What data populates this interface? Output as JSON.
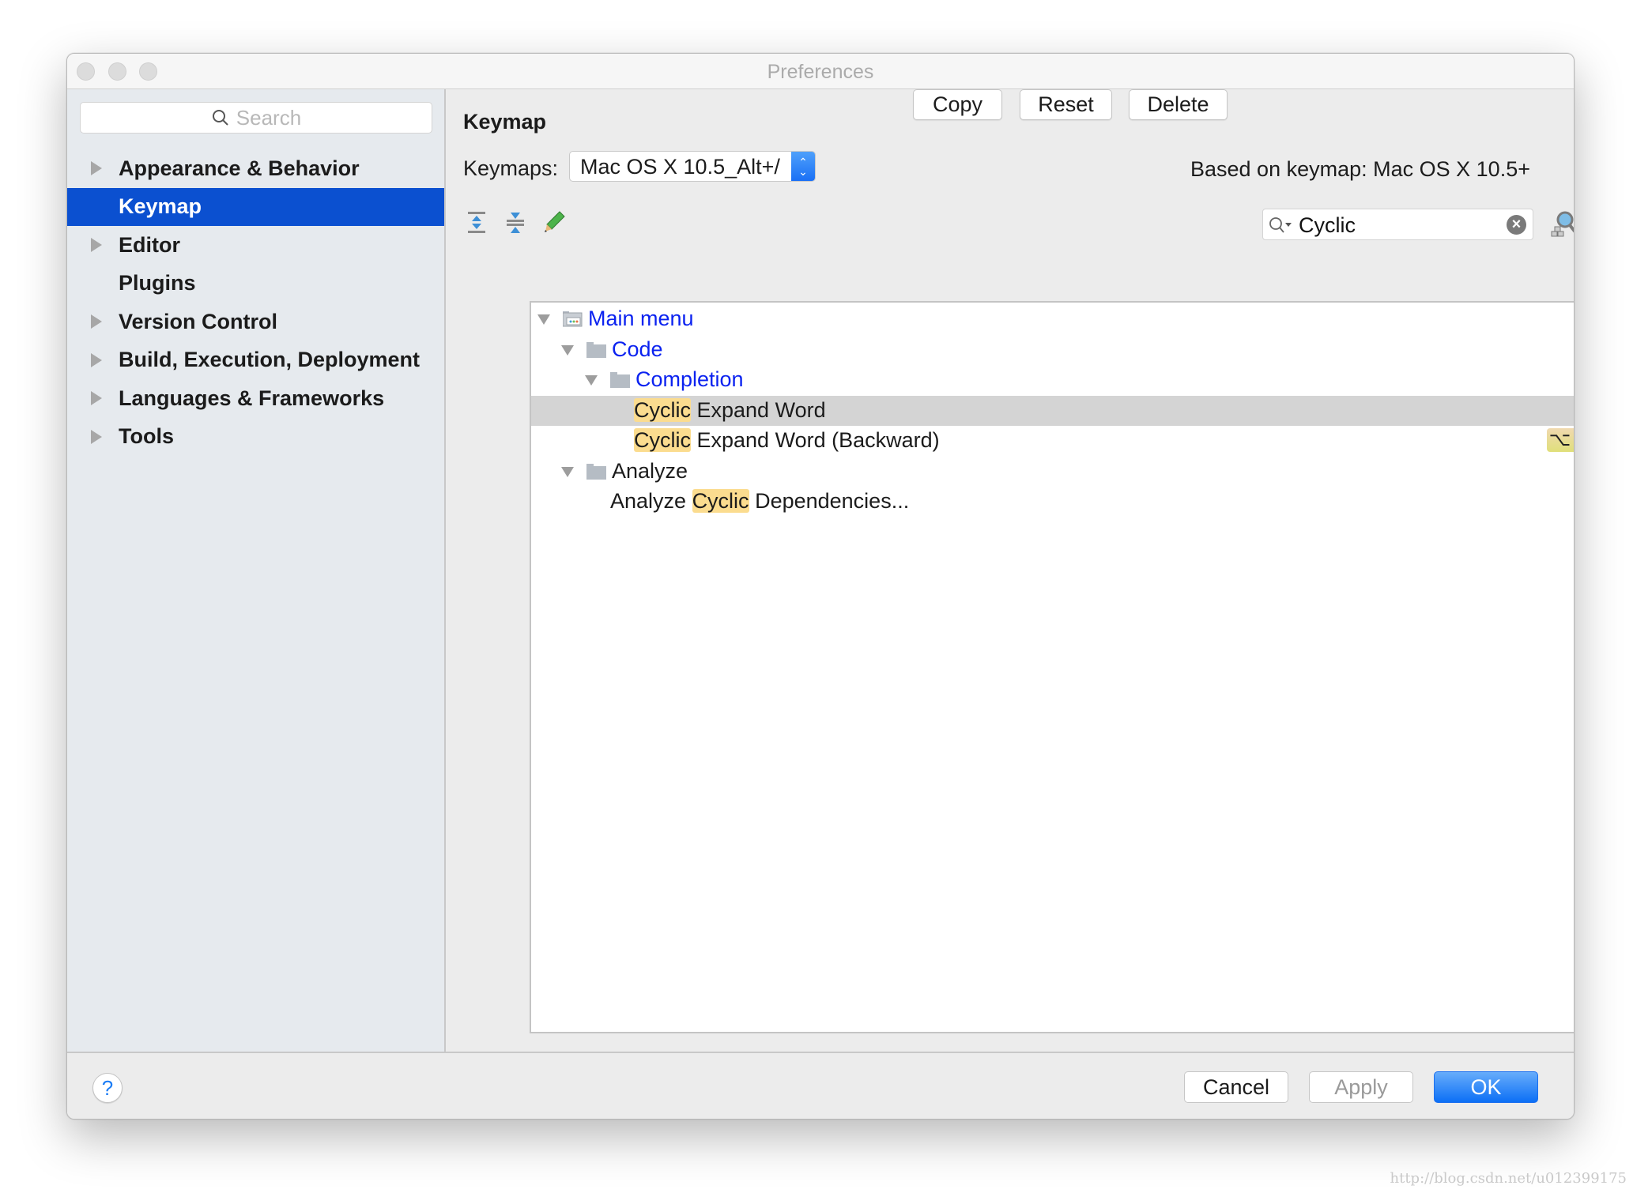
{
  "window": {
    "title": "Preferences"
  },
  "sidebar": {
    "search_placeholder": "Search",
    "items": [
      {
        "label": "Appearance & Behavior",
        "expandable": true,
        "selected": false
      },
      {
        "label": "Keymap",
        "expandable": false,
        "selected": true
      },
      {
        "label": "Editor",
        "expandable": true,
        "selected": false
      },
      {
        "label": "Plugins",
        "expandable": false,
        "selected": false
      },
      {
        "label": "Version Control",
        "expandable": true,
        "selected": false
      },
      {
        "label": "Build, Execution, Deployment",
        "expandable": true,
        "selected": false
      },
      {
        "label": "Languages & Frameworks",
        "expandable": true,
        "selected": false
      },
      {
        "label": "Tools",
        "expandable": true,
        "selected": false
      }
    ]
  },
  "keymap": {
    "heading": "Keymap",
    "keymaps_label": "Keymaps:",
    "selected_keymap": "Mac OS X 10.5_Alt+/",
    "copy_label": "Copy",
    "reset_label": "Reset",
    "delete_label": "Delete",
    "based_on": "Based on keymap: Mac OS X 10.5+",
    "toolbar": {
      "expand_all_icon": "expand-all-icon",
      "collapse_all_icon": "collapse-all-icon",
      "edit_icon": "pencil-icon"
    },
    "filter_value": "Cyclic",
    "find_by_shortcut_icon": "find-by-shortcut-icon"
  },
  "tree": {
    "rows": [
      {
        "level": 0,
        "expanded": true,
        "icon": "main-menu-icon",
        "pre": "",
        "match": "",
        "post": "Main menu",
        "link": true,
        "selected": false,
        "shortcut": ""
      },
      {
        "level": 1,
        "expanded": true,
        "icon": "folder-icon",
        "pre": "",
        "match": "",
        "post": "Code",
        "link": true,
        "selected": false,
        "shortcut": ""
      },
      {
        "level": 2,
        "expanded": true,
        "icon": "folder-icon",
        "pre": "",
        "match": "",
        "post": "Completion",
        "link": true,
        "selected": false,
        "shortcut": ""
      },
      {
        "level": 3,
        "expanded": null,
        "icon": "",
        "pre": "",
        "match": "Cyclic",
        "post": " Expand Word",
        "link": false,
        "selected": true,
        "shortcut": ""
      },
      {
        "level": 3,
        "expanded": null,
        "icon": "",
        "pre": "",
        "match": "Cyclic",
        "post": " Expand Word (Backward)",
        "link": false,
        "selected": false,
        "shortcut": "⌥⇧/"
      },
      {
        "level": 1,
        "expanded": true,
        "icon": "folder-icon",
        "pre": "",
        "match": "",
        "post": "Analyze",
        "link": false,
        "selected": false,
        "shortcut": ""
      },
      {
        "level": 2,
        "expanded": null,
        "icon": "",
        "pre": "Analyze ",
        "match": "Cyclic",
        "post": " Dependencies...",
        "link": false,
        "selected": false,
        "shortcut": ""
      }
    ]
  },
  "footer": {
    "help_label": "?",
    "cancel_label": "Cancel",
    "apply_label": "Apply",
    "ok_label": "OK"
  },
  "watermark": "http://blog.csdn.net/u012399175",
  "colors": {
    "selection": "#0b50d0",
    "link": "#0b22f0",
    "match_highlight": "#fbdc8f",
    "primary_button": "#0c6ff5"
  }
}
